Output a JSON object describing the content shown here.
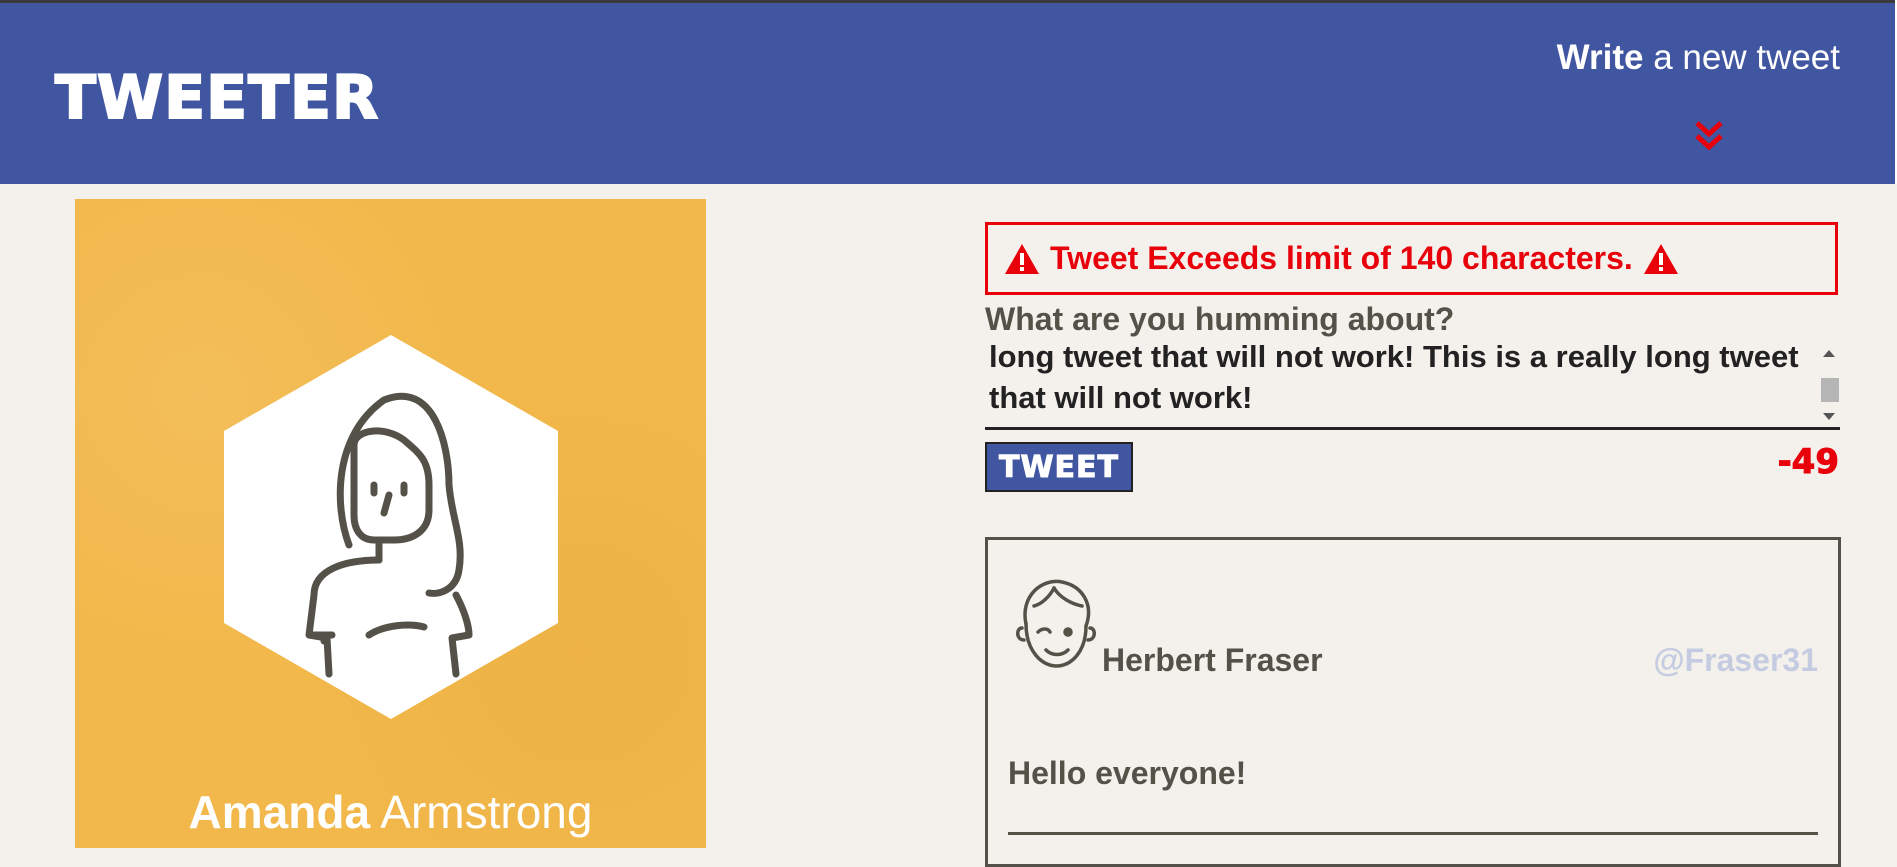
{
  "header": {
    "brand": "TWEETER",
    "compose_bold": "Write",
    "compose_rest": " a new tweet",
    "chevron_icon": "double-chevron-down-icon",
    "background_color": "#4056a1",
    "chevron_color": "#e8000b"
  },
  "profile": {
    "first_name": "Amanda",
    "last_name": "Armstrong",
    "avatar_icon": "woman-avatar-icon",
    "card_color": "#f2b84b"
  },
  "compose": {
    "error_message": "Tweet Exceeds limit of 140 characters.",
    "warning_icon": "warning-triangle-icon",
    "prompt_label": "What are you humming about?",
    "textarea_value": "long tweet that will not work! This is a really long tweet that will not work!",
    "submit_label": "TWEET",
    "char_counter": "-49",
    "error_color": "#e8000b"
  },
  "tweets": [
    {
      "author": "Herbert Fraser",
      "handle": "@Fraser31",
      "body": "Hello everyone!",
      "avatar_icon": "winking-man-avatar-icon"
    }
  ]
}
